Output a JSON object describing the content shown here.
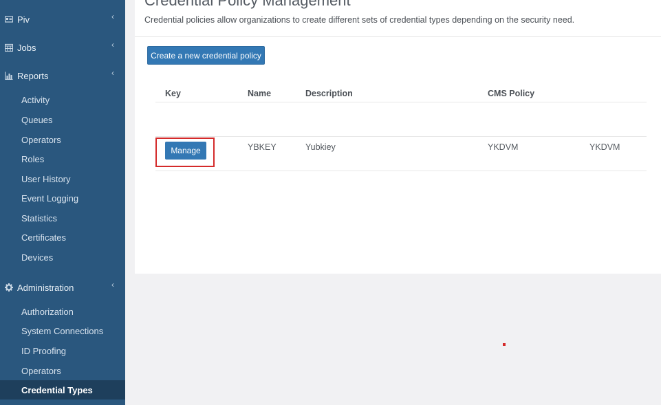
{
  "sidebar": {
    "sections": [
      {
        "label": "Piv",
        "icon": "id-card-icon"
      },
      {
        "label": "Jobs",
        "icon": "calendar-icon"
      },
      {
        "label": "Reports",
        "icon": "bar-chart-icon"
      },
      {
        "label": "Administration",
        "icon": "gear-icon"
      }
    ],
    "reports_items": [
      "Activity",
      "Queues",
      "Operators",
      "Roles",
      "User History",
      "Event Logging",
      "Statistics",
      "Certificates",
      "Devices"
    ],
    "admin_items": [
      "Authorization",
      "System Connections",
      "ID Proofing",
      "Operators",
      "Credential Types"
    ],
    "active_item": "Credential Types"
  },
  "main": {
    "title": "Credential Policy Management",
    "subtitle": "Credential policies allow organizations to create different sets of credential types depending on the security need.",
    "create_button": "Create a new credential policy",
    "table": {
      "headers": [
        "Key",
        "Name",
        "Description",
        "CMS Policy"
      ],
      "rows": [
        {
          "action": "Manage",
          "name": "YBKEY",
          "description": "Yubkiey",
          "cms_policy": "YKDVM",
          "extra": "YKDVM"
        }
      ]
    }
  },
  "colors": {
    "sidebar_bg": "#2a577e",
    "active_bg": "#1e3f5c",
    "accent": "#3378b4",
    "highlight": "#d42a2a"
  }
}
